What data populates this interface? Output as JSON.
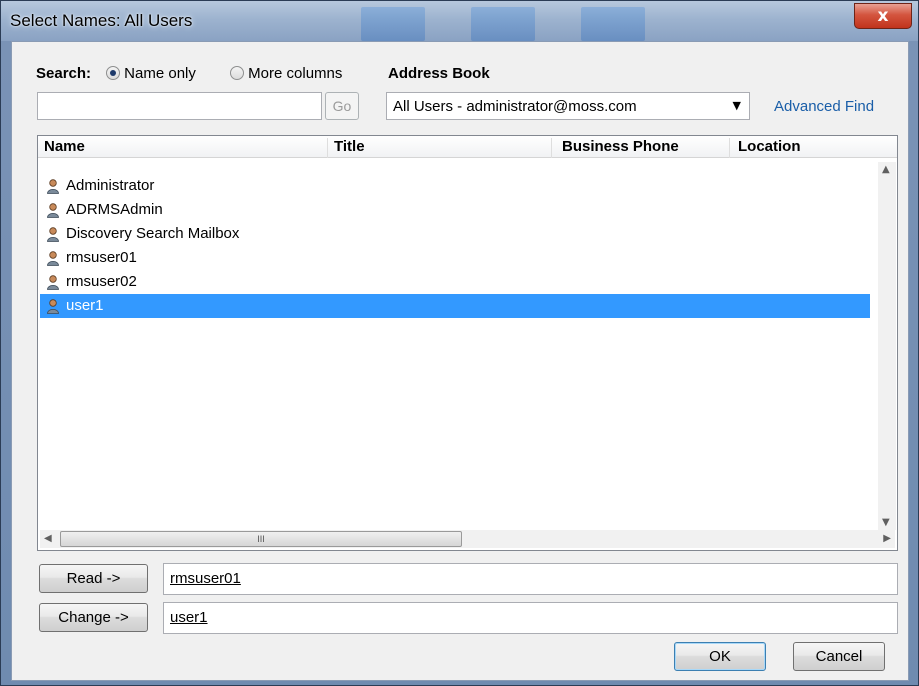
{
  "window": {
    "title": "Select Names: All Users",
    "close_label": "x"
  },
  "search": {
    "label": "Search:",
    "option_name_only": "Name only",
    "option_more_columns": "More columns",
    "selected": "Name only",
    "input_value": "",
    "go_label": "Go"
  },
  "address_book": {
    "label": "Address Book",
    "selected": "All Users - administrator@moss.com",
    "advanced_find": "Advanced Find"
  },
  "columns": [
    "Name",
    "Title",
    "Business Phone",
    "Location"
  ],
  "rows": [
    {
      "name": "Administrator"
    },
    {
      "name": "ADRMSAdmin"
    },
    {
      "name": "Discovery Search Mailbox"
    },
    {
      "name": "rmsuser01"
    },
    {
      "name": "rmsuser02"
    },
    {
      "name": "user1",
      "selected": true
    }
  ],
  "scrollbar": {
    "thumb_glyph": "III"
  },
  "assign": {
    "read_label": "Read ->",
    "read_value": "rmsuser01",
    "change_label": "Change ->",
    "change_value": "user1"
  },
  "footer": {
    "ok_label": "OK",
    "cancel_label": "Cancel"
  },
  "colors": {
    "selection": "#3399ff",
    "link": "#1a5ea8",
    "title_bar": "#9db3cf"
  }
}
